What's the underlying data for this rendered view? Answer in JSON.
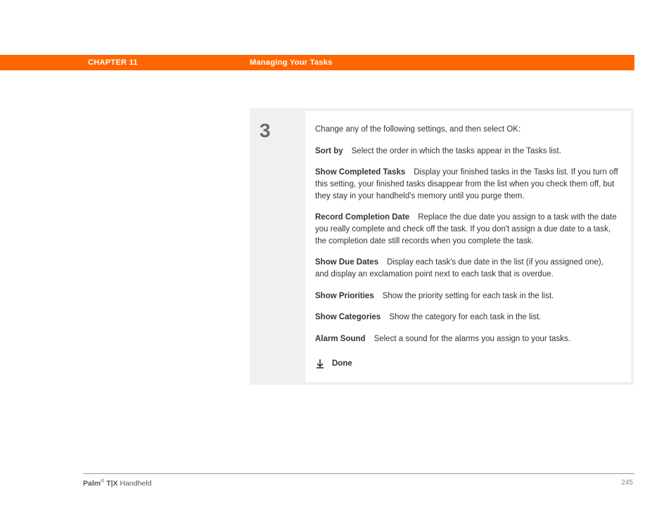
{
  "header": {
    "chapter_label": "CHAPTER 11",
    "chapter_title": "Managing Your Tasks"
  },
  "step": {
    "number": "3",
    "intro": "Change any of the following settings, and then select OK:",
    "settings": [
      {
        "name": "Sort by",
        "desc": "Select the order in which the tasks appear in the Tasks list."
      },
      {
        "name": "Show Completed Tasks",
        "desc": "Display your finished tasks in the Tasks list. If you turn off this setting, your finished tasks disappear from the list when you check them off, but they stay in your handheld's memory until you purge them."
      },
      {
        "name": "Record Completion Date",
        "desc": "Replace the due date you assign to a task with the date you really complete and check off the task. If you don't assign a due date to a task, the completion date still records when you complete the task."
      },
      {
        "name": "Show Due Dates",
        "desc": "Display each task's due date in the list (if you assigned one), and display an exclamation point next to each task that is overdue."
      },
      {
        "name": "Show Priorities",
        "desc": "Show the priority setting for each task in the list."
      },
      {
        "name": "Show Categories",
        "desc": "Show the category for each task in the list."
      },
      {
        "name": "Alarm Sound",
        "desc": "Select a sound for the alarms you assign to your tasks."
      }
    ],
    "done_label": "Done"
  },
  "footer": {
    "brand_bold1": "Palm",
    "reg": "®",
    "brand_bold2": " T|X",
    "brand_rest": " Handheld",
    "page_number": "245"
  }
}
